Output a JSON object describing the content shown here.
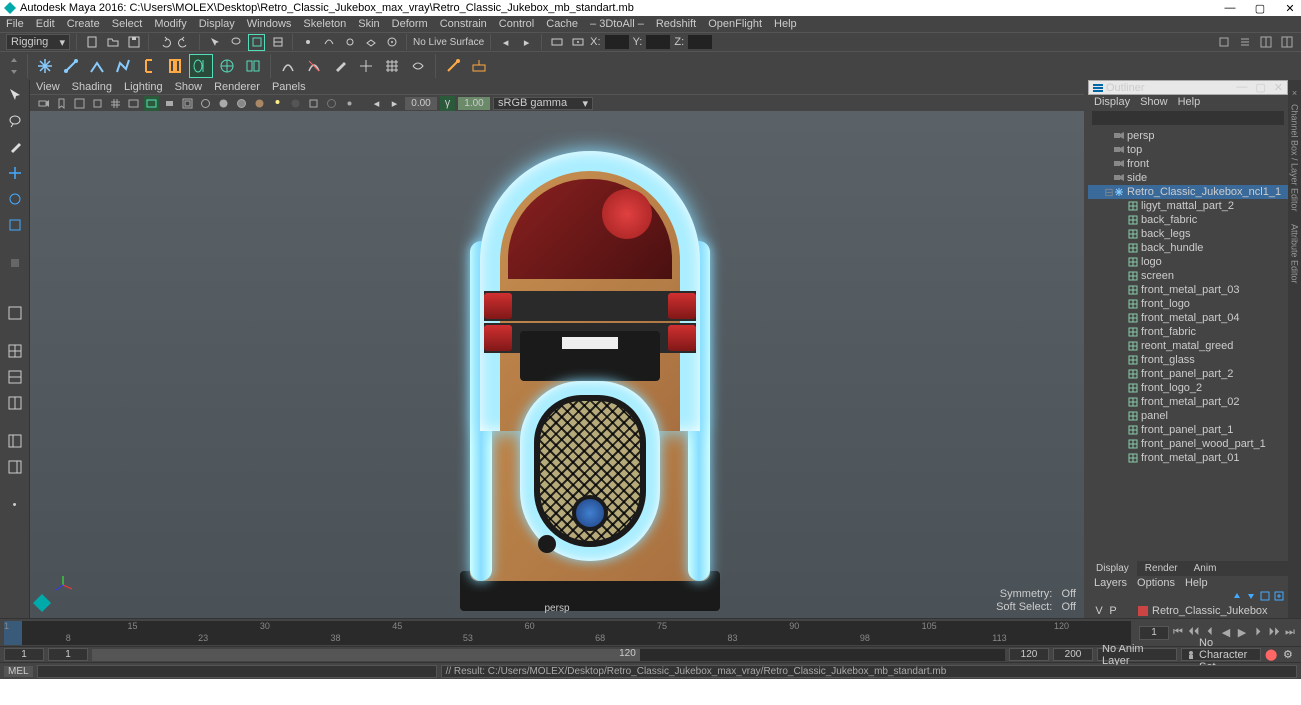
{
  "title": "Autodesk Maya 2016: C:\\Users\\MOLEX\\Desktop\\Retro_Classic_Jukebox_max_vray\\Retro_Classic_Jukebox_mb_standart.mb",
  "menubar": [
    "File",
    "Edit",
    "Create",
    "Select",
    "Modify",
    "Display",
    "Windows",
    "Skeleton",
    "Skin",
    "Deform",
    "Constrain",
    "Control",
    "Cache",
    "– 3DtoAll –",
    "Redshift",
    "OpenFlight",
    "Help"
  ],
  "mode_select": "Rigging",
  "status_text": "No Live Surface",
  "coord": {
    "x": "X:",
    "y": "Y:",
    "z": "Z:"
  },
  "viewport_menubar": [
    "View",
    "Shading",
    "Lighting",
    "Show",
    "Renderer",
    "Panels"
  ],
  "vp_num1": "0.00",
  "vp_num2": "1.00",
  "gamma_sel": "sRGB gamma",
  "camera_name": "persp",
  "symmetry_label": "Symmetry:",
  "symmetry_val": "Off",
  "softsel_label": "Soft Select:",
  "softsel_val": "Off",
  "outliner": {
    "title": "Outliner",
    "menu": [
      "Display",
      "Show",
      "Help"
    ],
    "rows": [
      {
        "depth": 0,
        "icon": "camera",
        "label": "persp"
      },
      {
        "depth": 0,
        "icon": "camera",
        "label": "top"
      },
      {
        "depth": 0,
        "icon": "camera",
        "label": "front"
      },
      {
        "depth": 0,
        "icon": "camera",
        "label": "side"
      },
      {
        "depth": 0,
        "icon": "group-open",
        "label": "Retro_Classic_Jukebox_ncl1_1",
        "selected": true
      },
      {
        "depth": 1,
        "icon": "mesh",
        "label": "ligyt_mattal_part_2"
      },
      {
        "depth": 1,
        "icon": "mesh",
        "label": "back_fabric"
      },
      {
        "depth": 1,
        "icon": "mesh",
        "label": "back_legs"
      },
      {
        "depth": 1,
        "icon": "mesh",
        "label": "back_hundle"
      },
      {
        "depth": 1,
        "icon": "mesh",
        "label": "logo"
      },
      {
        "depth": 1,
        "icon": "mesh",
        "label": "screen"
      },
      {
        "depth": 1,
        "icon": "mesh",
        "label": "front_metal_part_03"
      },
      {
        "depth": 1,
        "icon": "mesh",
        "label": "front_logo"
      },
      {
        "depth": 1,
        "icon": "mesh",
        "label": "front_metal_part_04"
      },
      {
        "depth": 1,
        "icon": "mesh",
        "label": "front_fabric"
      },
      {
        "depth": 1,
        "icon": "mesh",
        "label": "reont_matal_greed"
      },
      {
        "depth": 1,
        "icon": "mesh",
        "label": "front_glass"
      },
      {
        "depth": 1,
        "icon": "mesh",
        "label": "front_panel_part_2"
      },
      {
        "depth": 1,
        "icon": "mesh",
        "label": "front_logo_2"
      },
      {
        "depth": 1,
        "icon": "mesh",
        "label": "front_metal_part_02"
      },
      {
        "depth": 1,
        "icon": "mesh",
        "label": "panel"
      },
      {
        "depth": 1,
        "icon": "mesh",
        "label": "front_panel_part_1"
      },
      {
        "depth": 1,
        "icon": "mesh",
        "label": "front_panel_wood_part_1"
      },
      {
        "depth": 1,
        "icon": "mesh",
        "label": "front_metal_part_01"
      }
    ]
  },
  "right_tabs": [
    "Attribute Editor",
    "Channel Box / Layer Editor"
  ],
  "chbox": {
    "tabs": [
      "Display",
      "Render",
      "Anim"
    ],
    "menu": [
      "Layers",
      "Options",
      "Help"
    ],
    "layer_name": "Retro_Classic_Jukebox",
    "vcol": "V",
    "pcol": "P"
  },
  "timeline": {
    "ticks": [
      1,
      15,
      30,
      45,
      60,
      75,
      90,
      105,
      120
    ],
    "sub": [
      8,
      23,
      38,
      53,
      68,
      83,
      98,
      113
    ],
    "current": 1,
    "current_input": "1"
  },
  "range": {
    "start_outer": "1",
    "start_inner": "1",
    "end_inner": "120",
    "end_outer": "120",
    "end_outer2": "200",
    "anim_layer": "No Anim Layer",
    "char_set": "No Character Set"
  },
  "cmd": {
    "lang": "MEL",
    "result": "// Result: C:/Users/MOLEX/Desktop/Retro_Classic_Jukebox_max_vray/Retro_Classic_Jukebox_mb_standart.mb"
  }
}
